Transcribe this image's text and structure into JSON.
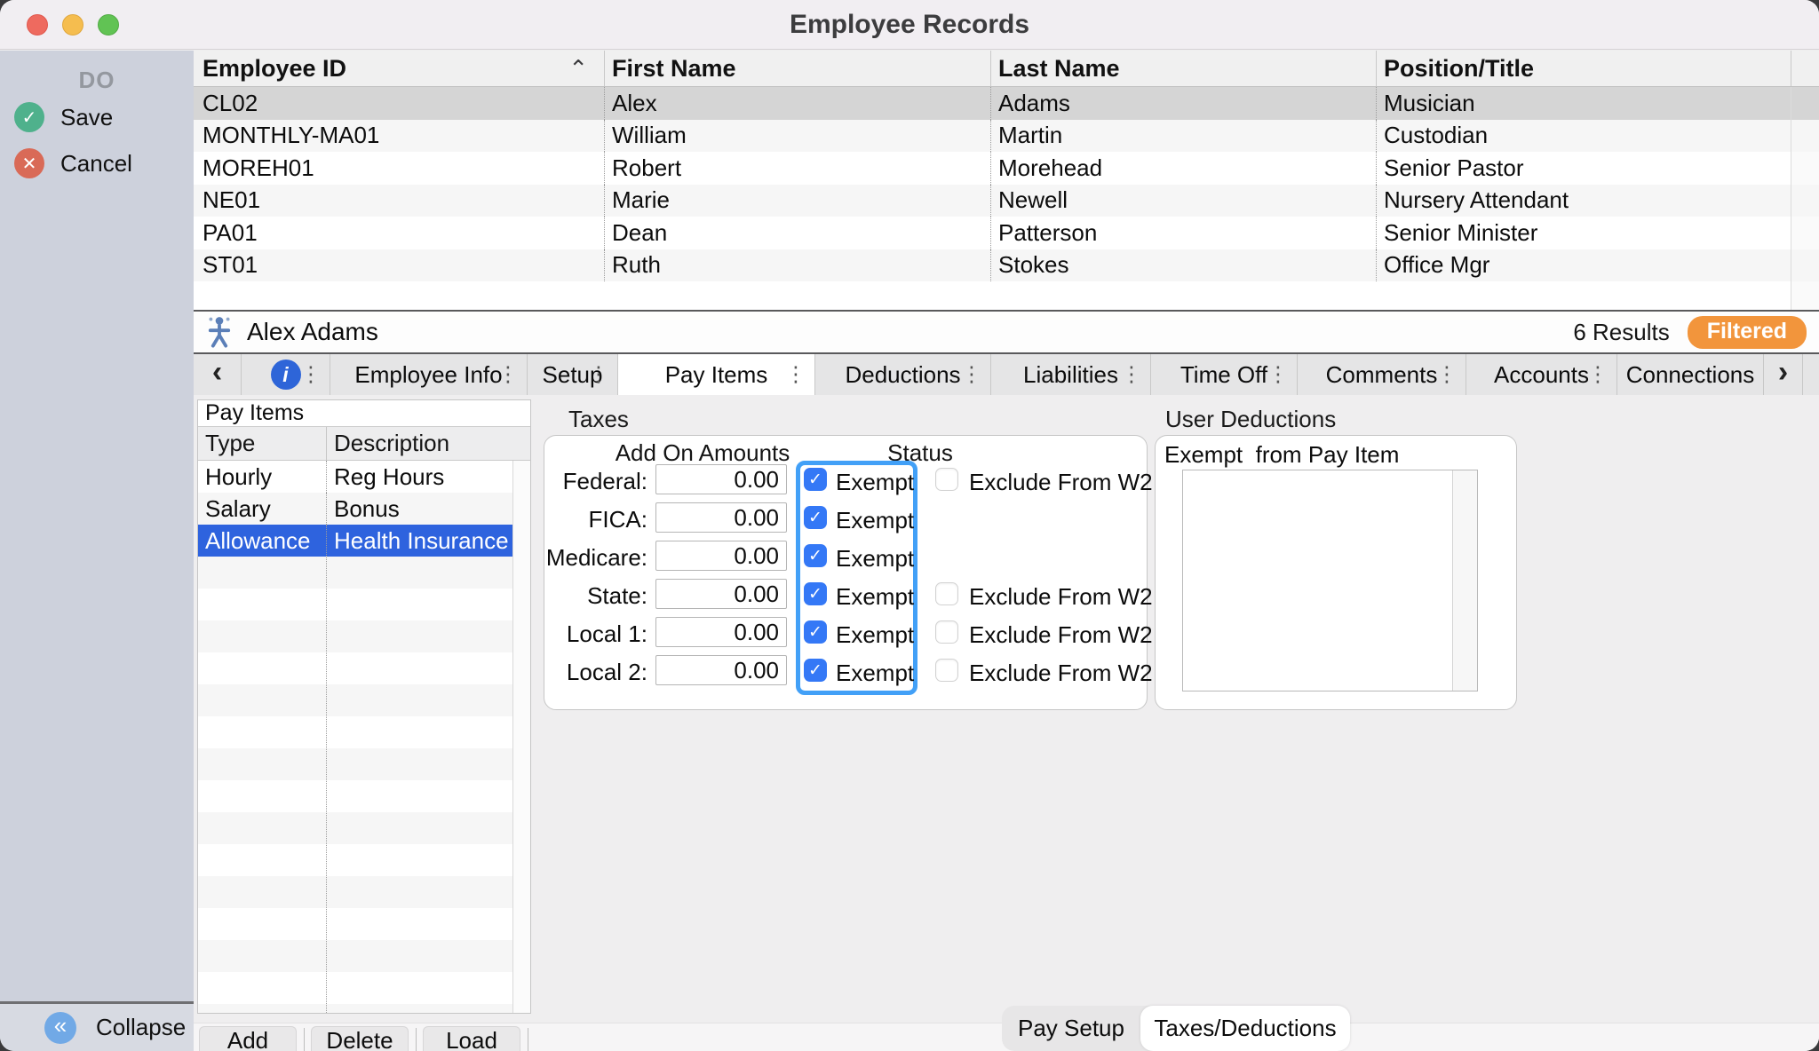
{
  "window": {
    "title": "Employee Records"
  },
  "icons": {
    "sort_asc": "⌃",
    "menu_dots": "⋮",
    "back_chevron": "‹",
    "forward_chevron": "›",
    "check": "✓",
    "cross": "✕",
    "collapse": "«",
    "info": "i"
  },
  "colors": {
    "selection_gray": "#d5d5d5",
    "row_stripe": "#f6f6f6",
    "pay_item_selected_blue": "#2e63de",
    "highlight_border_blue": "#42a0f7",
    "checkbox_blue": "#3478f6",
    "filtered_orange": "#f2953c",
    "save_green": "#4fb18c",
    "cancel_red": "#d96a57",
    "collapse_blue": "#71a9e6",
    "info_blue": "#2e65d8",
    "sidebar_bg": "#cdd1dc"
  },
  "sidebar": {
    "header": "DO",
    "save_label": "Save",
    "cancel_label": "Cancel",
    "collapse_label": "Collapse"
  },
  "employee_table": {
    "columns": [
      "Employee ID",
      "First Name",
      "Last Name",
      "Position/Title"
    ],
    "sorted_column": "Employee ID",
    "rows": [
      [
        "CL02",
        "Alex",
        "Adams",
        "Musician"
      ],
      [
        "MONTHLY-MA01",
        "William",
        "Martin",
        "Custodian"
      ],
      [
        "MOREH01",
        "Robert",
        "Morehead",
        "Senior Pastor"
      ],
      [
        "NE01",
        "Marie",
        "Newell",
        "Nursery Attendant"
      ],
      [
        "PA01",
        "Dean",
        "Patterson",
        "Senior Minister"
      ],
      [
        "ST01",
        "Ruth",
        "Stokes",
        "Office Mgr"
      ]
    ],
    "selected_row_id": "CL02"
  },
  "record_bar": {
    "name": "Alex Adams",
    "results": "6 Results",
    "badge": "Filtered"
  },
  "tab_bar": {
    "tabs": [
      "Employee Info",
      "Setup",
      "Pay Items",
      "Deductions",
      "Liabilities",
      "Time Off",
      "Comments",
      "Accounts",
      "Connections"
    ],
    "active": "Pay Items"
  },
  "pay_items": {
    "title": "Pay Items",
    "columns": [
      "Type",
      "Description"
    ],
    "rows": [
      [
        "Hourly",
        "Reg Hours"
      ],
      [
        "Salary",
        "Bonus"
      ],
      [
        "Allowance",
        "Health Insurance"
      ]
    ],
    "selected_row_type": "Allowance",
    "buttons": [
      "Add",
      "Delete",
      "Load"
    ]
  },
  "taxes": {
    "label": "Taxes",
    "amounts_header": "Add On Amounts",
    "status_header": "Status",
    "rows": [
      {
        "label": "Federal:",
        "amount": "0.00",
        "exempt_label": "Exempt",
        "exempt_checked": true,
        "w2_label": "Exclude From W2",
        "w2_checked": false
      },
      {
        "label": "FICA:",
        "amount": "0.00",
        "exempt_label": "Exempt",
        "exempt_checked": true
      },
      {
        "label": "Medicare:",
        "amount": "0.00",
        "exempt_label": "Exempt",
        "exempt_checked": true
      },
      {
        "label": "State:",
        "amount": "0.00",
        "exempt_label": "Exempt",
        "exempt_checked": true,
        "w2_label": "Exclude From W2",
        "w2_checked": false
      },
      {
        "label": "Local 1:",
        "amount": "0.00",
        "exempt_label": "Exempt",
        "exempt_checked": true,
        "w2_label": "Exclude From W2",
        "w2_checked": false
      },
      {
        "label": "Local 2:",
        "amount": "0.00",
        "exempt_label": "Exempt",
        "exempt_checked": true,
        "w2_label": "Exclude From W2",
        "w2_checked": false
      }
    ]
  },
  "user_deductions": {
    "label": "User Deductions",
    "box_label": "Exempt  from Pay Item"
  },
  "bottom_tabs": {
    "tabs": [
      "Pay Setup",
      "Taxes/Deductions"
    ],
    "active": "Taxes/Deductions"
  }
}
